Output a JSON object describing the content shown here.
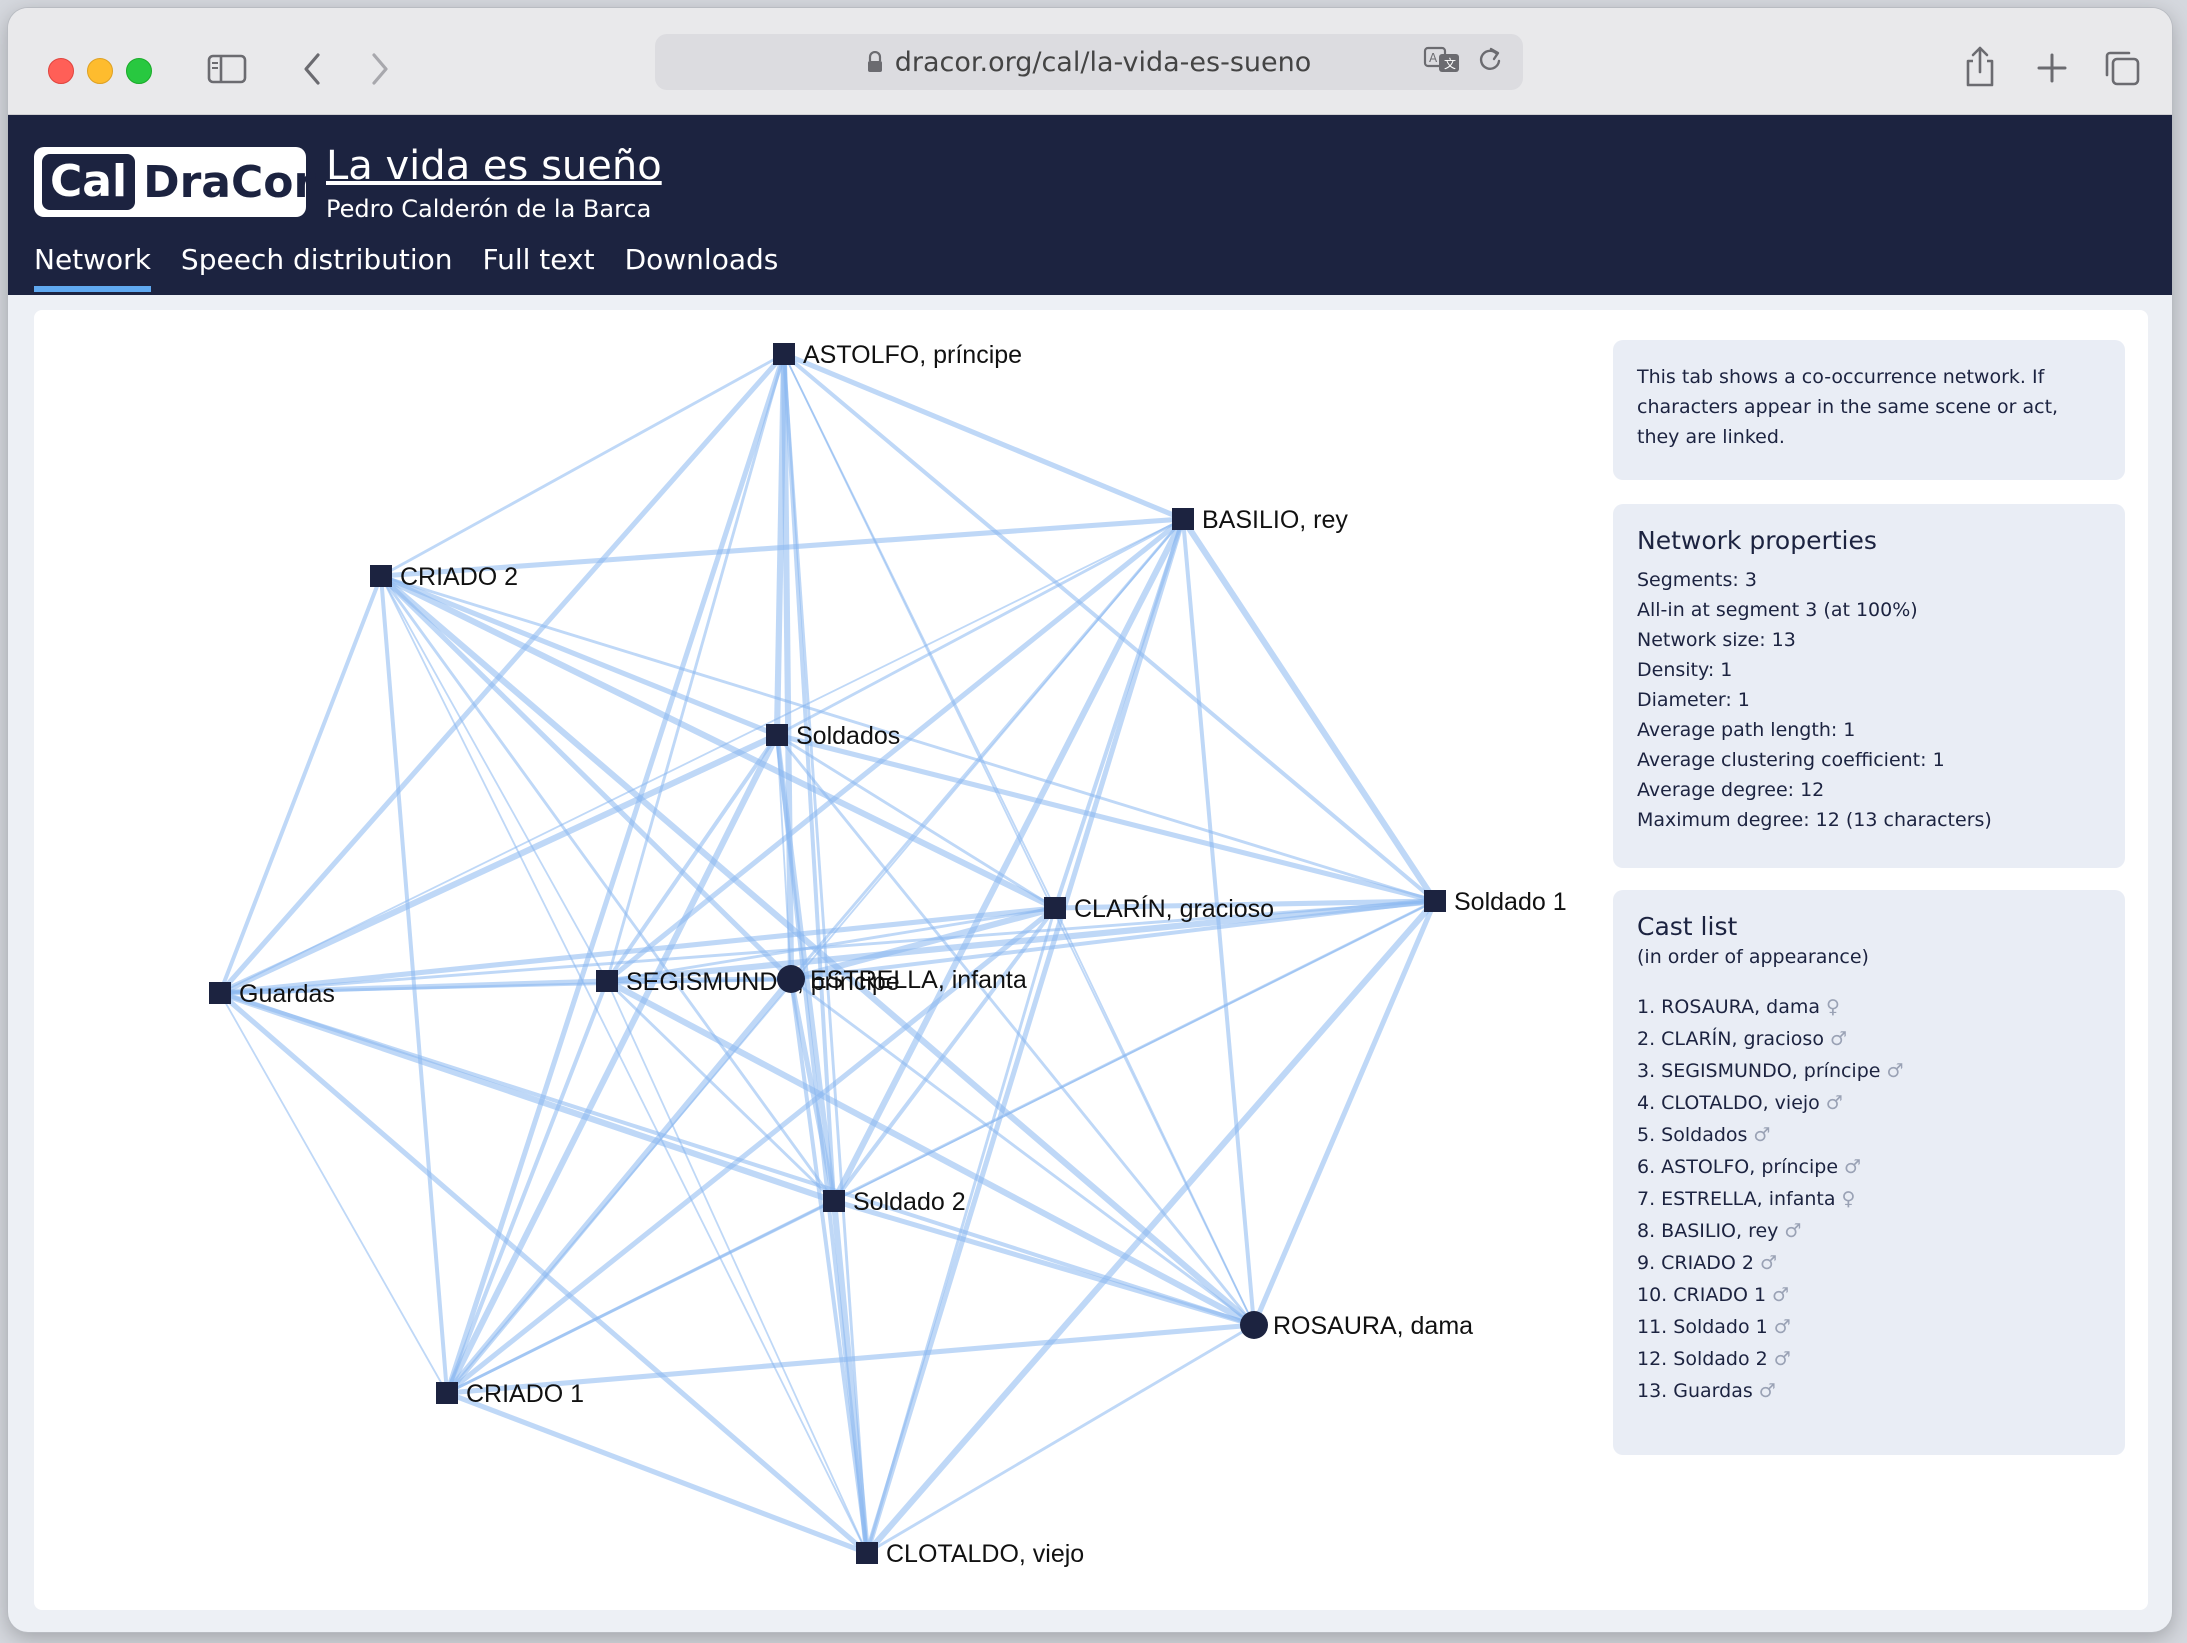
{
  "browser": {
    "url": "dracor.org/cal/la-vida-es-sueno"
  },
  "site": {
    "logo_cal": "Cal",
    "logo_dracor": "DraCor",
    "play_title": "La vida es sueño",
    "author": "Pedro Calderón de la Barca",
    "tabs": [
      {
        "label": "Network",
        "active": true
      },
      {
        "label": "Speech distribution",
        "active": false
      },
      {
        "label": "Full text",
        "active": false
      },
      {
        "label": "Downloads",
        "active": false
      }
    ]
  },
  "network": {
    "nodes": [
      {
        "label": "ASTOLFO, príncipe",
        "shape": "square"
      },
      {
        "label": "BASILIO, rey",
        "shape": "square"
      },
      {
        "label": "CRIADO 2",
        "shape": "square"
      },
      {
        "label": "Soldados",
        "shape": "square"
      },
      {
        "label": "Soldado 1",
        "shape": "square"
      },
      {
        "label": "CLARÍN, gracioso",
        "shape": "square"
      },
      {
        "label": "Guardas",
        "shape": "square"
      },
      {
        "label": "SEGISMUNDO, príncipe",
        "shape": "square"
      },
      {
        "label": "ESTRELLA, infanta",
        "shape": "circle"
      },
      {
        "label": "Soldado 2",
        "shape": "square"
      },
      {
        "label": "ROSAURA, dama",
        "shape": "circle"
      },
      {
        "label": "CRIADO 1",
        "shape": "square"
      },
      {
        "label": "CLOTALDO, viejo",
        "shape": "square"
      }
    ],
    "edge_color": "#8ab8f0",
    "node_color": "#1c2340"
  },
  "sidebar": {
    "intro": "This tab shows a co-occurrence network. If characters appear in the same scene or act, they are linked.",
    "properties_title": "Network properties",
    "properties": [
      "Segments: 3",
      "All-in at segment 3 (at 100%)",
      "Network size: 13",
      "Density: 1",
      "Diameter: 1",
      "Average path length: 1",
      "Average clustering coefficient: 1",
      "Average degree: 12",
      "Maximum degree: 12 (13 characters)"
    ],
    "cast_title": "Cast list",
    "cast_subtitle": "(in order of appearance)",
    "cast": [
      {
        "label": "1. ROSAURA, dama",
        "gender": "♀"
      },
      {
        "label": "2. CLARÍN, gracioso",
        "gender": "♂"
      },
      {
        "label": "3. SEGISMUNDO, príncipe",
        "gender": "♂"
      },
      {
        "label": "4. CLOTALDO, viejo",
        "gender": "♂"
      },
      {
        "label": "5. Soldados",
        "gender": "♂"
      },
      {
        "label": "6. ASTOLFO, príncipe",
        "gender": "♂"
      },
      {
        "label": "7. ESTRELLA, infanta",
        "gender": "♀"
      },
      {
        "label": "8. BASILIO, rey",
        "gender": "♂"
      },
      {
        "label": "9. CRIADO 2",
        "gender": "♂"
      },
      {
        "label": "10. CRIADO 1",
        "gender": "♂"
      },
      {
        "label": "11. Soldado 1",
        "gender": "♂"
      },
      {
        "label": "12. Soldado 2",
        "gender": "♂"
      },
      {
        "label": "13. Guardas",
        "gender": "♂"
      }
    ]
  }
}
